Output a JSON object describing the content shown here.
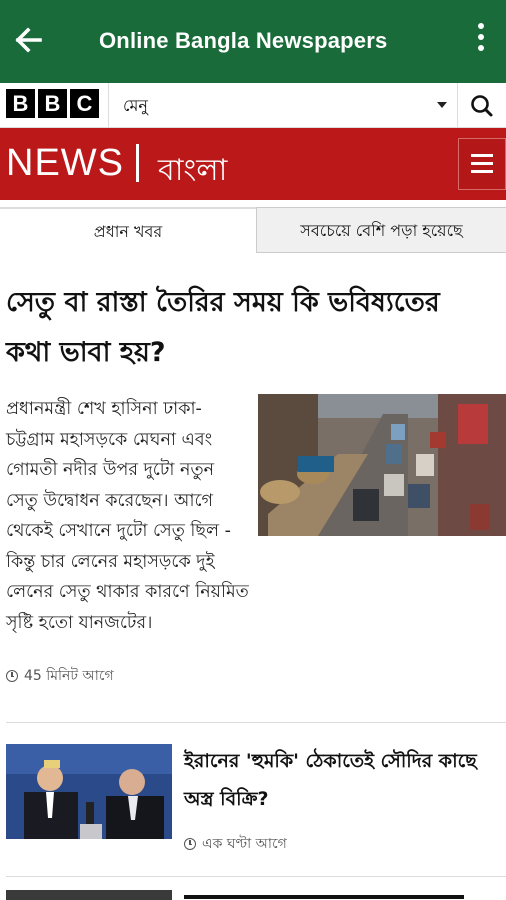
{
  "appbar": {
    "title": "Online Bangla Newspapers",
    "color": "#1a6b3a"
  },
  "bbc": {
    "logo_letters": [
      "B",
      "B",
      "C"
    ],
    "menu_label": "মেনু"
  },
  "newsbar": {
    "news": "NEWS",
    "language": "বাংলা",
    "color": "#bb1919"
  },
  "tabs": [
    {
      "label": "প্রধান খবর",
      "active": true
    },
    {
      "label": "সবচেয়ে বেশি পড়া হয়েছে",
      "active": false
    }
  ],
  "lead": {
    "headline": "সেতু বা রাস্তা তৈরির সময় কি ভবিষ্যতের কথা ভাবা হয়?",
    "summary": "প্রধানমন্ত্রী শেখ হাসিনা ঢাকা-চট্টগ্রাম মহাসড়কে মেঘনা এবং গোমতী নদীর উপর দুটো নতুন সেতু উদ্বোধন করেছেন। আগে থেকেই সেখানে দুটো সেতু ছিল - কিন্তু চার লেনের মহাসড়কে দুই লেনের সেতু থাকার কারণে নিয়মিত সৃষ্টি হতো যানজটের।",
    "time": "45 মিনিট আগে"
  },
  "story2": {
    "title": "ইরানের 'হুমকি' ঠেকাতেই সৌদির কাছে অস্ত্র বিক্রি?",
    "time": "এক ঘণ্টা আগে"
  },
  "icons": {
    "back": "back-arrow-icon",
    "more": "more-vert-icon",
    "search": "search-icon",
    "menu": "hamburger-icon",
    "clock": "clock-icon"
  }
}
